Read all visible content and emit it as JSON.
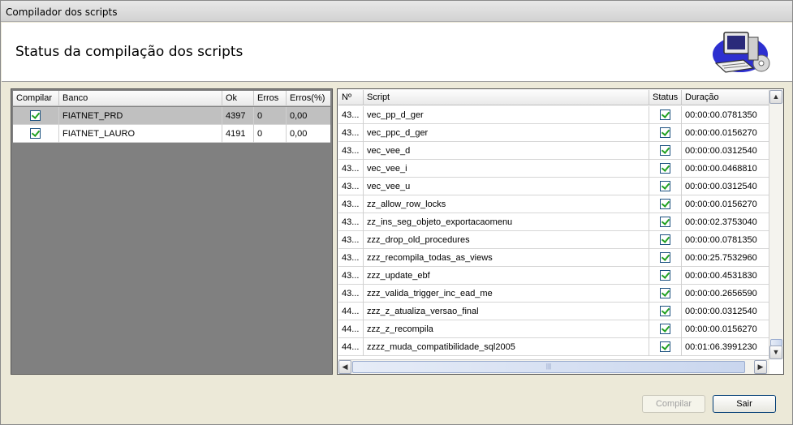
{
  "window": {
    "title": "Compilador dos scripts"
  },
  "header": {
    "heading": "Status da compilação dos scripts",
    "logo_icon": "computer-setup-icon"
  },
  "databases": {
    "columns": [
      "Compilar",
      "Banco",
      "Ok",
      "Erros",
      "Erros(%)"
    ],
    "rows": [
      {
        "compilar": true,
        "banco": "FIATNET_PRD",
        "ok": "4397",
        "erros": "0",
        "erros_pct": "0,00",
        "selected": true
      },
      {
        "compilar": true,
        "banco": "FIATNET_LAURO",
        "ok": "4191",
        "erros": "0",
        "erros_pct": "0,00",
        "selected": false
      }
    ]
  },
  "scripts": {
    "columns": [
      "Nº",
      "Script",
      "Status",
      "Duração"
    ],
    "rows": [
      {
        "num": "43...",
        "script": "vec_pp_d_ger",
        "status": true,
        "duracao": "00:00:00.0781350"
      },
      {
        "num": "43...",
        "script": "vec_ppc_d_ger",
        "status": true,
        "duracao": "00:00:00.0156270"
      },
      {
        "num": "43...",
        "script": "vec_vee_d",
        "status": true,
        "duracao": "00:00:00.0312540"
      },
      {
        "num": "43...",
        "script": "vec_vee_i",
        "status": true,
        "duracao": "00:00:00.0468810"
      },
      {
        "num": "43...",
        "script": "vec_vee_u",
        "status": true,
        "duracao": "00:00:00.0312540"
      },
      {
        "num": "43...",
        "script": "zz_allow_row_locks",
        "status": true,
        "duracao": "00:00:00.0156270"
      },
      {
        "num": "43...",
        "script": "zz_ins_seg_objeto_exportacaomenu",
        "status": true,
        "duracao": "00:00:02.3753040"
      },
      {
        "num": "43...",
        "script": "zzz_drop_old_procedures",
        "status": true,
        "duracao": "00:00:00.0781350"
      },
      {
        "num": "43...",
        "script": "zzz_recompila_todas_as_views",
        "status": true,
        "duracao": "00:00:25.7532960"
      },
      {
        "num": "43...",
        "script": "zzz_update_ebf",
        "status": true,
        "duracao": "00:00:00.4531830"
      },
      {
        "num": "43...",
        "script": "zzz_valida_trigger_inc_ead_me",
        "status": true,
        "duracao": "00:00:00.2656590"
      },
      {
        "num": "44...",
        "script": "zzz_z_atualiza_versao_final",
        "status": true,
        "duracao": "00:00:00.0312540"
      },
      {
        "num": "44...",
        "script": "zzz_z_recompila",
        "status": true,
        "duracao": "00:00:00.0156270"
      },
      {
        "num": "44...",
        "script": "zzzz_muda_compatibilidade_sql2005",
        "status": true,
        "duracao": "00:01:06.3991230"
      }
    ]
  },
  "buttons": {
    "compilar": "Compilar",
    "compilar_enabled": false,
    "sair": "Sair"
  },
  "colors": {
    "panel_bg": "#808080",
    "selected_row": "#c0c0c0",
    "check_green": "#21a121",
    "button_border": "#003c74"
  }
}
